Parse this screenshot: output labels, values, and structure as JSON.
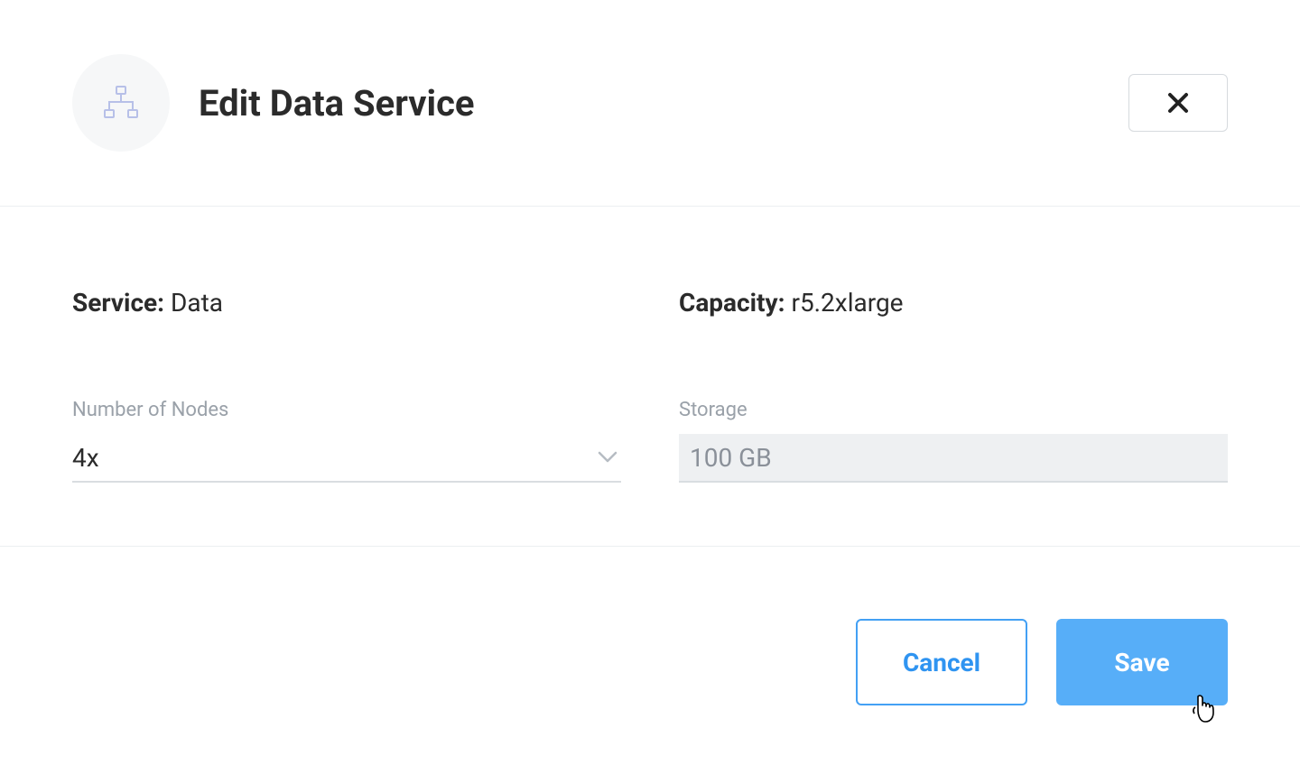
{
  "header": {
    "title": "Edit Data Service"
  },
  "form": {
    "service_label": "Service:",
    "service_value": "Data",
    "capacity_label": "Capacity:",
    "capacity_value": "r5.2xlarge",
    "nodes_label": "Number of Nodes",
    "nodes_value": "4x",
    "storage_label": "Storage",
    "storage_value": "100 GB"
  },
  "footer": {
    "cancel": "Cancel",
    "save": "Save"
  }
}
